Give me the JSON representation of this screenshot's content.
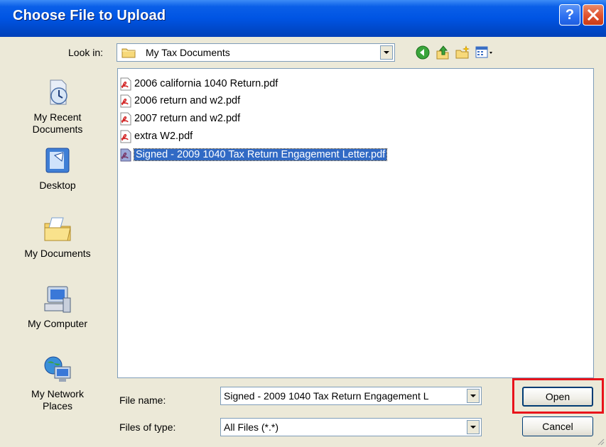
{
  "window": {
    "title": "Choose File to Upload",
    "help_label": "?",
    "close_label": "✕"
  },
  "lookin": {
    "label": "Look in:",
    "value": "My Tax Documents"
  },
  "toolbar": {
    "icons": [
      "back-icon",
      "up-folder-icon",
      "new-folder-icon",
      "views-menu-icon"
    ]
  },
  "places": [
    {
      "label": "My Recent\nDocuments",
      "icon": "recent-documents-icon"
    },
    {
      "label": "Desktop",
      "icon": "desktop-icon"
    },
    {
      "label": "My Documents",
      "icon": "my-documents-icon"
    },
    {
      "label": "My Computer",
      "icon": "my-computer-icon"
    },
    {
      "label": "My Network\nPlaces",
      "icon": "network-places-icon"
    }
  ],
  "files": [
    {
      "name": "2006 california 1040 Return.pdf",
      "selected": false
    },
    {
      "name": "2006 return and w2.pdf",
      "selected": false
    },
    {
      "name": "2007 return and w2.pdf",
      "selected": false
    },
    {
      "name": "extra W2.pdf",
      "selected": false
    },
    {
      "name": "Signed - 2009 1040 Tax Return Engagement Letter.pdf",
      "selected": true
    }
  ],
  "filename": {
    "label": "File name:",
    "value": "Signed - 2009 1040 Tax Return Engagement L"
  },
  "filetype": {
    "label": "Files of type:",
    "value": "All Files (*.*)"
  },
  "buttons": {
    "open": "Open",
    "cancel": "Cancel"
  },
  "colors": {
    "titlebar": "#0054e3",
    "selection": "#316ac5",
    "highlight": "#e8131b",
    "dialog_bg": "#ece9d8"
  }
}
